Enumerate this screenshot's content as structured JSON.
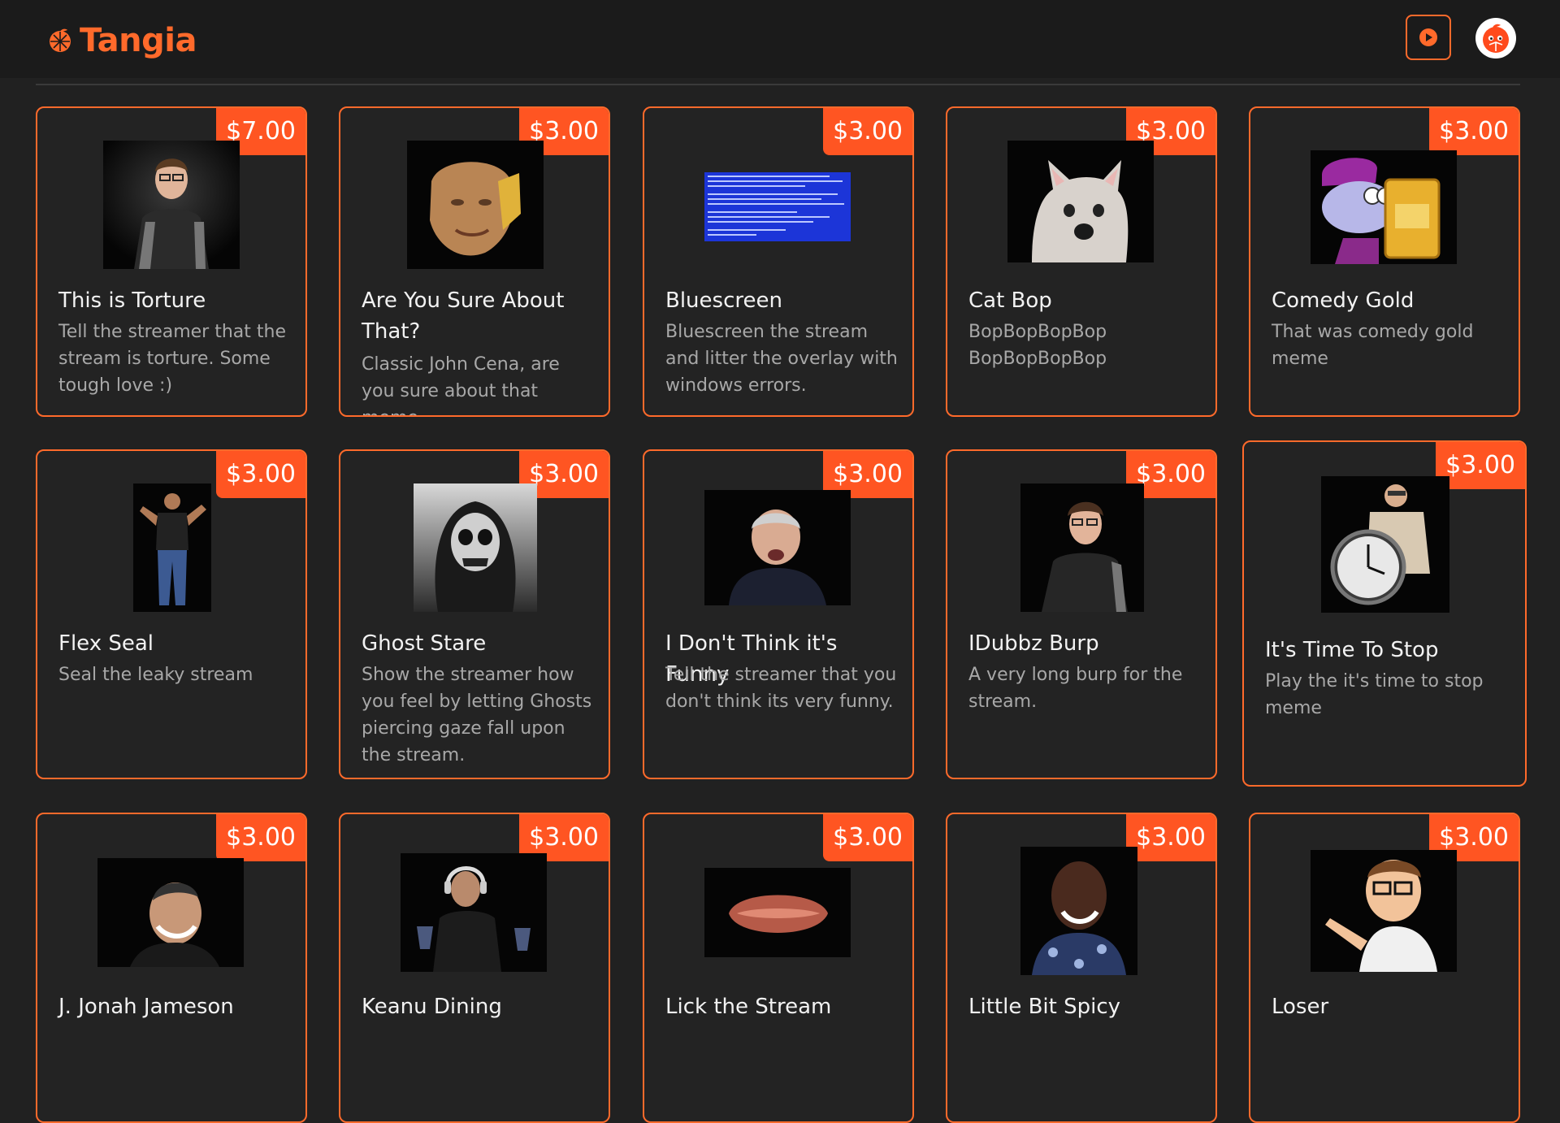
{
  "app": {
    "name": "Tangia"
  },
  "colors": {
    "accent": "#ff6a2b",
    "background": "#212121",
    "header": "#1b1b1b",
    "card": "#232323"
  },
  "cards": [
    {
      "price": "$7.00",
      "title": "This is Torture",
      "description": "Tell the streamer that the stream is torture. Some tough love :)"
    },
    {
      "price": "$3.00",
      "title": "Are You Sure About That?",
      "description": "Classic John Cena, are you sure about that meme"
    },
    {
      "price": "$3.00",
      "title": "Bluescreen",
      "description": "Bluescreen the stream and litter the overlay with windows errors."
    },
    {
      "price": "$3.00",
      "title": "Cat Bop",
      "description": "BopBopBopBop BopBopBopBop"
    },
    {
      "price": "$3.00",
      "title": "Comedy Gold",
      "description": "That was comedy gold meme"
    },
    {
      "price": "$3.00",
      "title": "Flex Seal",
      "description": "Seal the leaky stream"
    },
    {
      "price": "$3.00",
      "title": "Ghost Stare",
      "description": "Show the streamer how you feel by letting Ghosts piercing gaze fall upon the stream."
    },
    {
      "price": "$3.00",
      "title": "I Don't Think it's Funny",
      "description": "Tell the streamer that you don't think its very funny."
    },
    {
      "price": "$3.00",
      "title": "IDubbz Burp",
      "description": "A very long burp for the stream."
    },
    {
      "price": "$3.00",
      "title": "It's Time To Stop",
      "description": "Play the it's time to stop meme"
    },
    {
      "price": "$3.00",
      "title": "J. Jonah Jameson",
      "description": ""
    },
    {
      "price": "$3.00",
      "title": "Keanu Dining",
      "description": ""
    },
    {
      "price": "$3.00",
      "title": "Lick the Stream",
      "description": ""
    },
    {
      "price": "$3.00",
      "title": "Little Bit Spicy",
      "description": ""
    },
    {
      "price": "$3.00",
      "title": "Loser",
      "description": ""
    }
  ]
}
